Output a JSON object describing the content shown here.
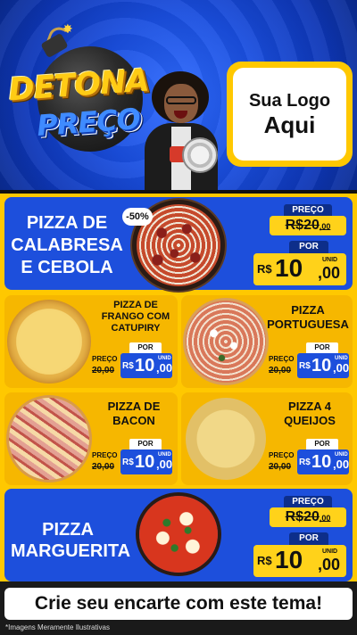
{
  "header": {
    "title_line1": "DETONA",
    "title_line2": "PREÇO",
    "logo_line1": "Sua Logo",
    "logo_line2": "Aqui"
  },
  "featured": [
    {
      "name_lines": [
        "PIZZA DE",
        "CALABRESA",
        "E CEBOLA"
      ],
      "badge": "-50%",
      "old_label": "PREÇO",
      "old_price_int": "20",
      "old_price_cents": ",00",
      "new_label": "POR",
      "currency": "R$",
      "new_price_int": "10",
      "new_price_cents": ",00",
      "unit": "UNID"
    },
    {
      "name_lines": [
        "PIZZA",
        "MARGUERITA"
      ],
      "old_label": "PREÇO",
      "old_price_int": "20",
      "old_price_cents": ",00",
      "new_label": "POR",
      "currency": "R$",
      "new_price_int": "10",
      "new_price_cents": ",00",
      "unit": "UNID"
    }
  ],
  "grid": [
    {
      "name_lines": [
        "PIZZA DE",
        "FRANGO COM",
        "CATUPIRY"
      ],
      "old_label": "PREÇO",
      "old_price": "20,00",
      "new_label": "POR",
      "currency": "R$",
      "new_price_int": "10",
      "new_price_cents": ",00",
      "unit": "UNID"
    },
    {
      "name_lines": [
        "PIZZA",
        "PORTUGUESA"
      ],
      "old_label": "PREÇO",
      "old_price": "20,00",
      "new_label": "POR",
      "currency": "R$",
      "new_price_int": "10",
      "new_price_cents": ",00",
      "unit": "UNID"
    },
    {
      "name_lines": [
        "PIZZA DE",
        "BACON"
      ],
      "old_label": "PREÇO",
      "old_price": "20,00",
      "new_label": "POR",
      "currency": "R$",
      "new_price_int": "10",
      "new_price_cents": ",00",
      "unit": "UNID"
    },
    {
      "name_lines": [
        "PIZZA 4",
        "QUEIJOS"
      ],
      "old_label": "PREÇO",
      "old_price": "20,00",
      "new_label": "POR",
      "currency": "R$",
      "new_price_int": "10",
      "new_price_cents": ",00",
      "unit": "UNID"
    }
  ],
  "cta": "Crie seu encarte com este tema!",
  "disclaimer": "*Imagens Meramente Ilustrativas",
  "colors": {
    "brand_blue": "#1d4fdc",
    "brand_yellow": "#ffc800",
    "price_yellow": "#ffd21a",
    "dark": "#1a1a1a"
  }
}
